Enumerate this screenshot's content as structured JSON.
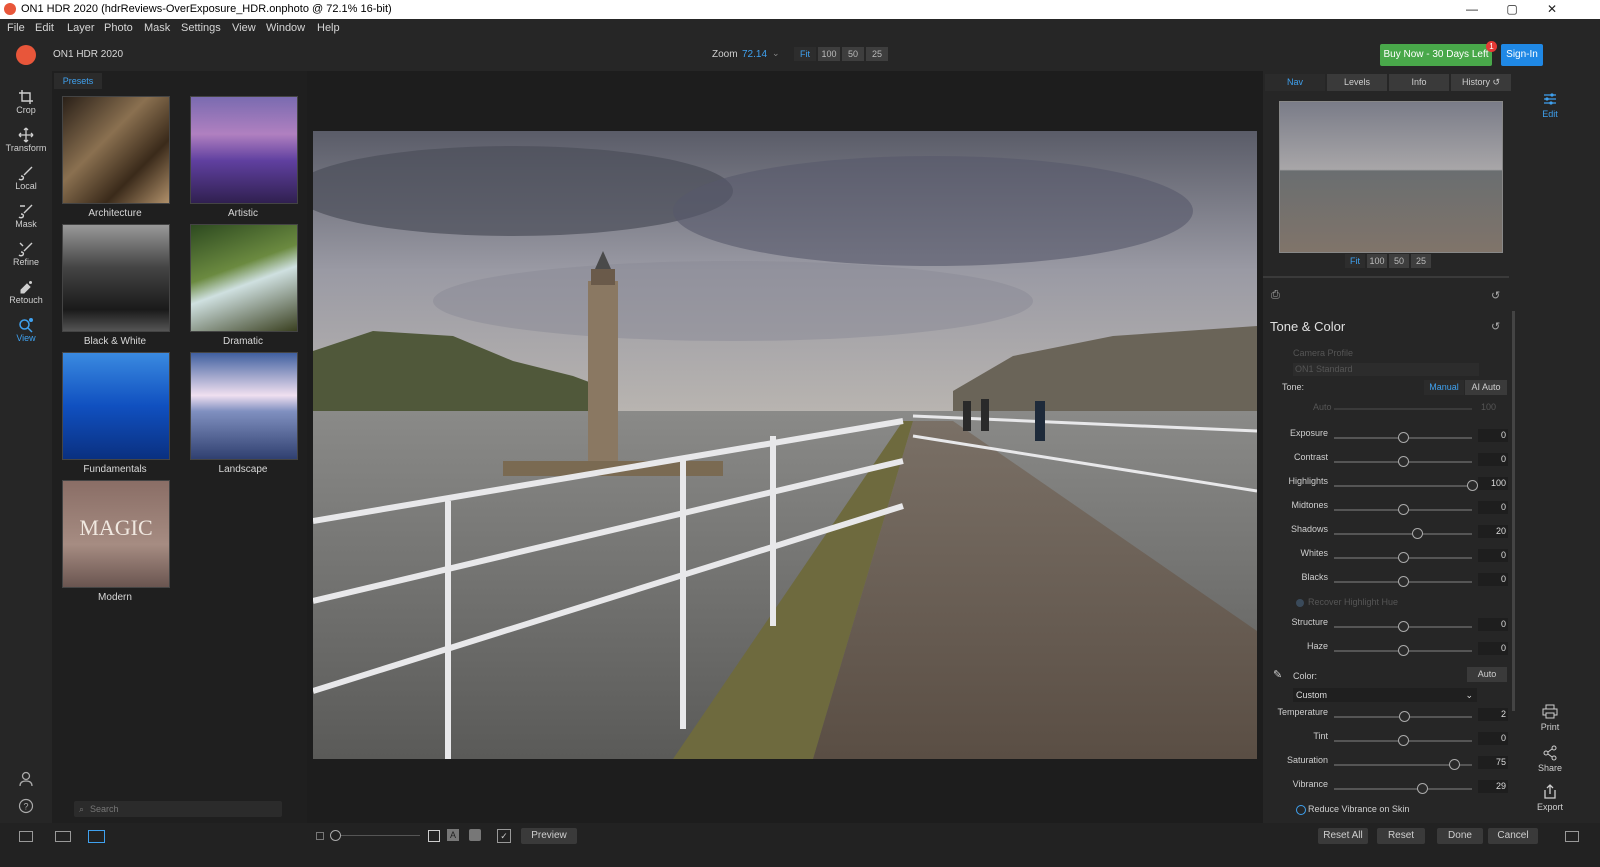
{
  "window": {
    "title": "ON1 HDR 2020 (hdrReviews-OverExposure_HDR.onphoto @ 72.1% 16-bit)",
    "minimize": "—",
    "maximize": "▢",
    "close": "✕"
  },
  "menu": [
    "File",
    "Edit",
    "Layer",
    "Photo",
    "Mask",
    "Settings",
    "View",
    "Window",
    "Help"
  ],
  "header": {
    "app_name": "ON1 HDR 2020",
    "zoom_label": "Zoom",
    "zoom_value": "72.14",
    "zoom_buttons": [
      "Fit",
      "100",
      "50",
      "25"
    ],
    "buy_now": "Buy Now - 30 Days Left",
    "badge": "1",
    "sign_in": "Sign-In"
  },
  "tools": [
    {
      "label": "Crop",
      "icon": "crop-icon"
    },
    {
      "label": "Transform",
      "icon": "transform-icon"
    },
    {
      "label": "Local",
      "icon": "brush-icon"
    },
    {
      "label": "Mask",
      "icon": "mask-brush-icon"
    },
    {
      "label": "Refine",
      "icon": "refine-brush-icon"
    },
    {
      "label": "Retouch",
      "icon": "retouch-icon"
    },
    {
      "label": "View",
      "icon": "view-icon"
    }
  ],
  "presets": {
    "tab": "Presets",
    "items": [
      {
        "label": "Architecture",
        "color": "#6b5a46"
      },
      {
        "label": "Artistic",
        "color": "#5a4b8a"
      },
      {
        "label": "Black & White",
        "color": "#3a3a3a"
      },
      {
        "label": "Dramatic",
        "color": "#3f5a32"
      },
      {
        "label": "Fundamentals",
        "color": "#1f5fb8"
      },
      {
        "label": "Landscape",
        "color": "#6d7fa8"
      },
      {
        "label": "Modern",
        "color": "#9a7c72"
      }
    ],
    "modern_text": "MAGIC",
    "search_placeholder": "Search"
  },
  "bottom": {
    "preview": "Preview",
    "reset_all": "Reset All",
    "reset": "Reset",
    "done": "Done",
    "cancel": "Cancel"
  },
  "right_panel": {
    "tabs": [
      "Nav",
      "Levels",
      "Info",
      "History"
    ],
    "nav_zoom": [
      "Fit",
      "100",
      "50",
      "25"
    ],
    "section_title": "Tone & Color",
    "camera_profile_label": "Camera Profile",
    "camera_profile_value": "ON1 Standard",
    "tone_label": "Tone:",
    "tone_manual": "Manual",
    "tone_ai_auto": "AI Auto",
    "auto_label": "Auto",
    "auto_value": "100",
    "sliders_tone": [
      {
        "label": "Exposure",
        "value": "0",
        "pos": 0.5
      },
      {
        "label": "Contrast",
        "value": "0",
        "pos": 0.5
      },
      {
        "label": "Highlights",
        "value": "100",
        "pos": 1.0
      },
      {
        "label": "Midtones",
        "value": "0",
        "pos": 0.5
      },
      {
        "label": "Shadows",
        "value": "20",
        "pos": 0.6
      },
      {
        "label": "Whites",
        "value": "0",
        "pos": 0.5
      },
      {
        "label": "Blacks",
        "value": "0",
        "pos": 0.5
      }
    ],
    "recover_label": "Recover Highlight Hue",
    "sliders_struct": [
      {
        "label": "Structure",
        "value": "0",
        "pos": 0.5
      },
      {
        "label": "Haze",
        "value": "0",
        "pos": 0.5
      }
    ],
    "color_label": "Color:",
    "color_auto": "Auto",
    "color_preset": "Custom",
    "sliders_color": [
      {
        "label": "Temperature",
        "value": "2",
        "pos": 0.51
      },
      {
        "label": "Tint",
        "value": "0",
        "pos": 0.5
      },
      {
        "label": "Saturation",
        "value": "75",
        "pos": 0.87
      },
      {
        "label": "Vibrance",
        "value": "29",
        "pos": 0.64
      }
    ],
    "reduce_vibrance": "Reduce Vibrance on Skin"
  },
  "right_icons": [
    {
      "label": "Edit",
      "icon": "edit-sliders-icon"
    },
    {
      "label": "Print",
      "icon": "print-icon"
    },
    {
      "label": "Share",
      "icon": "share-icon"
    },
    {
      "label": "Export",
      "icon": "export-icon"
    }
  ]
}
